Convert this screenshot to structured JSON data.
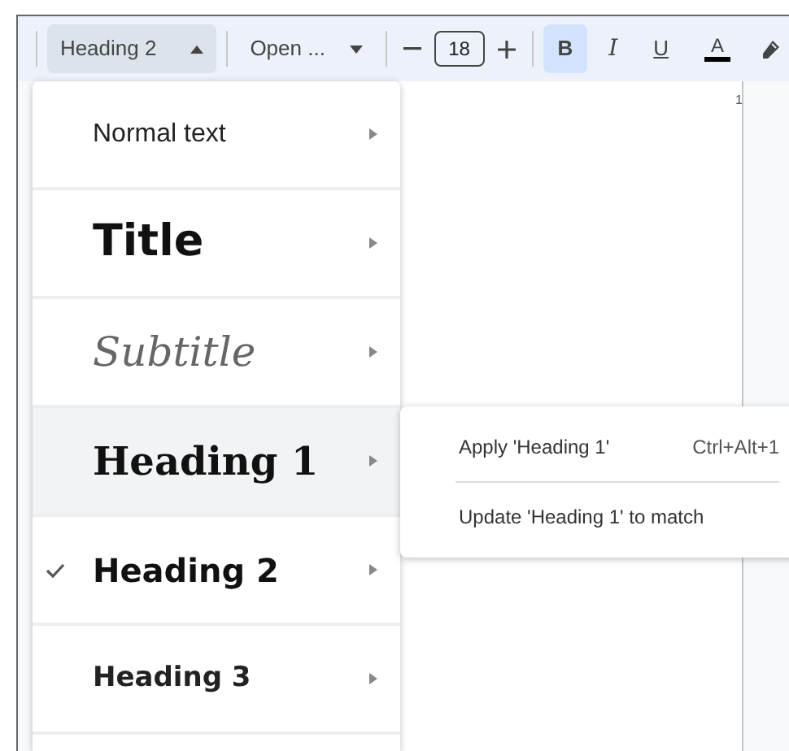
{
  "toolbar": {
    "style_dropdown": {
      "label": "Heading 2",
      "expanded": true
    },
    "font_dropdown": {
      "label": "Open ...",
      "expanded": false
    },
    "font_size": {
      "value": "18"
    },
    "format_buttons": [
      {
        "kind": "bold",
        "label": "B",
        "selected": true
      },
      {
        "kind": "italic",
        "label": "I",
        "selected": false
      },
      {
        "kind": "underline",
        "label": "U",
        "selected": false
      },
      {
        "kind": "color",
        "label": "A",
        "selected": false,
        "color": "#000000"
      }
    ]
  },
  "ruler": {
    "mark": "1"
  },
  "style_menu": {
    "items": [
      {
        "kind": "normal",
        "label": "Normal text",
        "checked": false,
        "highlighted": false
      },
      {
        "kind": "title",
        "label": "Title",
        "checked": false,
        "highlighted": false
      },
      {
        "kind": "subtitle",
        "label": "Subtitle",
        "checked": false,
        "highlighted": false
      },
      {
        "kind": "heading1",
        "label": "Heading 1",
        "checked": false,
        "highlighted": true
      },
      {
        "kind": "heading2",
        "label": "Heading 2",
        "checked": true,
        "highlighted": false
      },
      {
        "kind": "heading3",
        "label": "Heading 3",
        "checked": false,
        "highlighted": false
      }
    ]
  },
  "submenu": {
    "items": [
      {
        "label": "Apply 'Heading 1'",
        "shortcut": "Ctrl+Alt+1"
      },
      {
        "label": "Update 'Heading 1' to match"
      }
    ]
  }
}
